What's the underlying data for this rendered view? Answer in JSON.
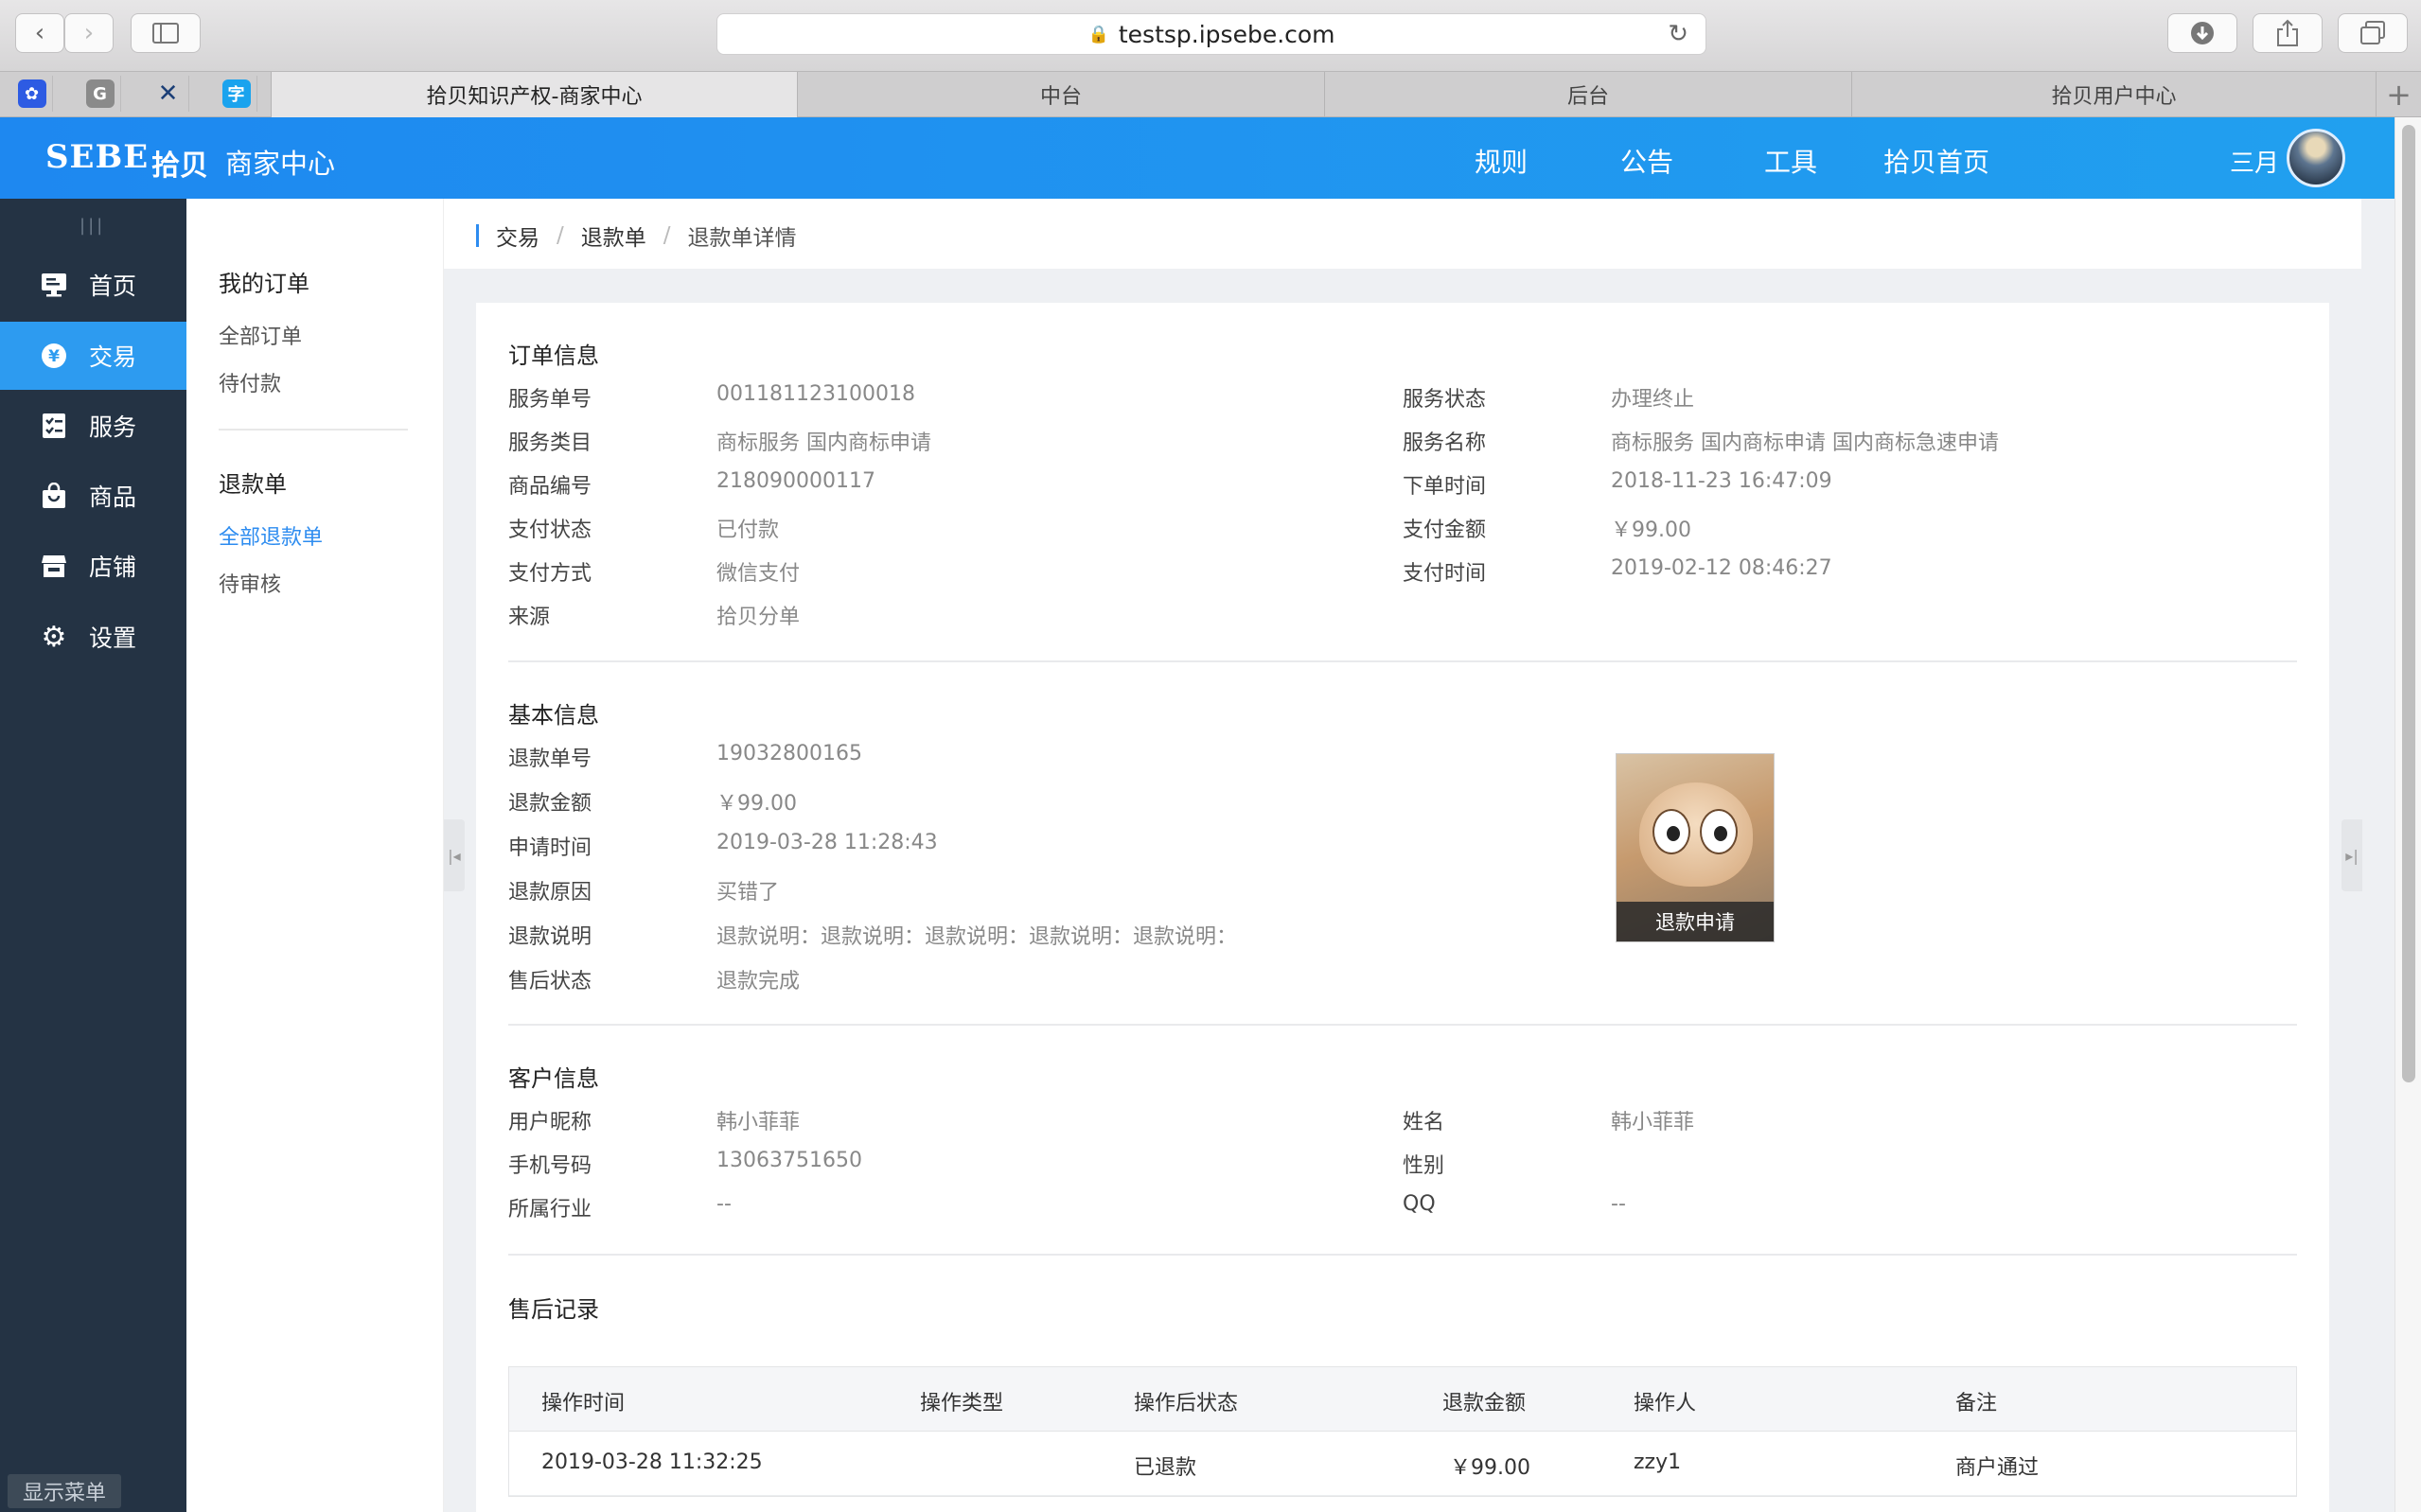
{
  "browser": {
    "url": "testsp.ipsebe.com",
    "tabs": [
      {
        "label": "拾贝知识产权-商家中心",
        "active": true
      },
      {
        "label": "中台",
        "active": false
      },
      {
        "label": "后台",
        "active": false
      },
      {
        "label": "拾贝用户中心",
        "active": false
      }
    ],
    "favorites": [
      "baidu-icon",
      "g-icon",
      "figure-icon",
      "word-icon"
    ]
  },
  "header": {
    "logo": "SEBE",
    "logo_cn": "拾贝",
    "subtitle": "商家中心",
    "nav": [
      "规则",
      "公告",
      "工具",
      "拾贝首页"
    ],
    "user": "三月"
  },
  "sidebar": {
    "items": [
      {
        "label": "首页",
        "icon": "monitor-icon"
      },
      {
        "label": "交易",
        "icon": "yen-icon",
        "active": true
      },
      {
        "label": "服务",
        "icon": "checklist-icon"
      },
      {
        "label": "商品",
        "icon": "bag-icon"
      },
      {
        "label": "店铺",
        "icon": "store-icon"
      },
      {
        "label": "设置",
        "icon": "gear-icon"
      }
    ],
    "show_menu": "显示菜单"
  },
  "submenu": {
    "group1_title": "我的订单",
    "group1_links": [
      "全部订单",
      "待付款"
    ],
    "group2_title": "退款单",
    "group2_links": [
      "全部退款单",
      "待审核"
    ]
  },
  "breadcrumb": [
    "交易",
    "退款单",
    "退款单详情"
  ],
  "order_info": {
    "title": "订单信息",
    "left": [
      {
        "label": "服务单号",
        "value": "001181123100018"
      },
      {
        "label": "服务类目",
        "value": "商标服务  国内商标申请"
      },
      {
        "label": "商品编号",
        "value": "218090000117"
      },
      {
        "label": "支付状态",
        "value": "已付款"
      },
      {
        "label": "支付方式",
        "value": "微信支付"
      },
      {
        "label": "来源",
        "value": "拾贝分单"
      }
    ],
    "right": [
      {
        "label": "服务状态",
        "value": "办理终止"
      },
      {
        "label": "服务名称",
        "value": "商标服务  国内商标申请  国内商标急速申请"
      },
      {
        "label": "下单时间",
        "value": "2018-11-23 16:47:09"
      },
      {
        "label": "支付金额",
        "value": "￥99.00"
      },
      {
        "label": "支付时间",
        "value": "2019-02-12 08:46:27"
      }
    ]
  },
  "basic_info": {
    "title": "基本信息",
    "fields": [
      {
        "label": "退款单号",
        "value": "19032800165"
      },
      {
        "label": "退款金额",
        "value": "￥99.00"
      },
      {
        "label": "申请时间",
        "value": "2019-03-28 11:28:43"
      },
      {
        "label": "退款原因",
        "value": "买错了"
      },
      {
        "label": "退款说明",
        "value": "退款说明：退款说明：退款说明：退款说明：退款说明："
      },
      {
        "label": "售后状态",
        "value": "退款完成"
      }
    ],
    "image_caption": "退款申请"
  },
  "customer_info": {
    "title": "客户信息",
    "left": [
      {
        "label": "用户昵称",
        "value": "韩小菲菲"
      },
      {
        "label": "手机号码",
        "value": "13063751650"
      },
      {
        "label": "所属行业",
        "value": "--"
      }
    ],
    "right": [
      {
        "label": "姓名",
        "value": "韩小菲菲"
      },
      {
        "label": "性别",
        "value": ""
      },
      {
        "label": "QQ",
        "value": "--"
      }
    ]
  },
  "after_sale": {
    "title": "售后记录",
    "columns": [
      "操作时间",
      "操作类型",
      "操作后状态",
      "退款金额",
      "操作人",
      "备注"
    ],
    "rows": [
      [
        "2019-03-28 11:32:25",
        "",
        "已退款",
        "￥99.00",
        "zzy1",
        "商户通过"
      ]
    ]
  }
}
